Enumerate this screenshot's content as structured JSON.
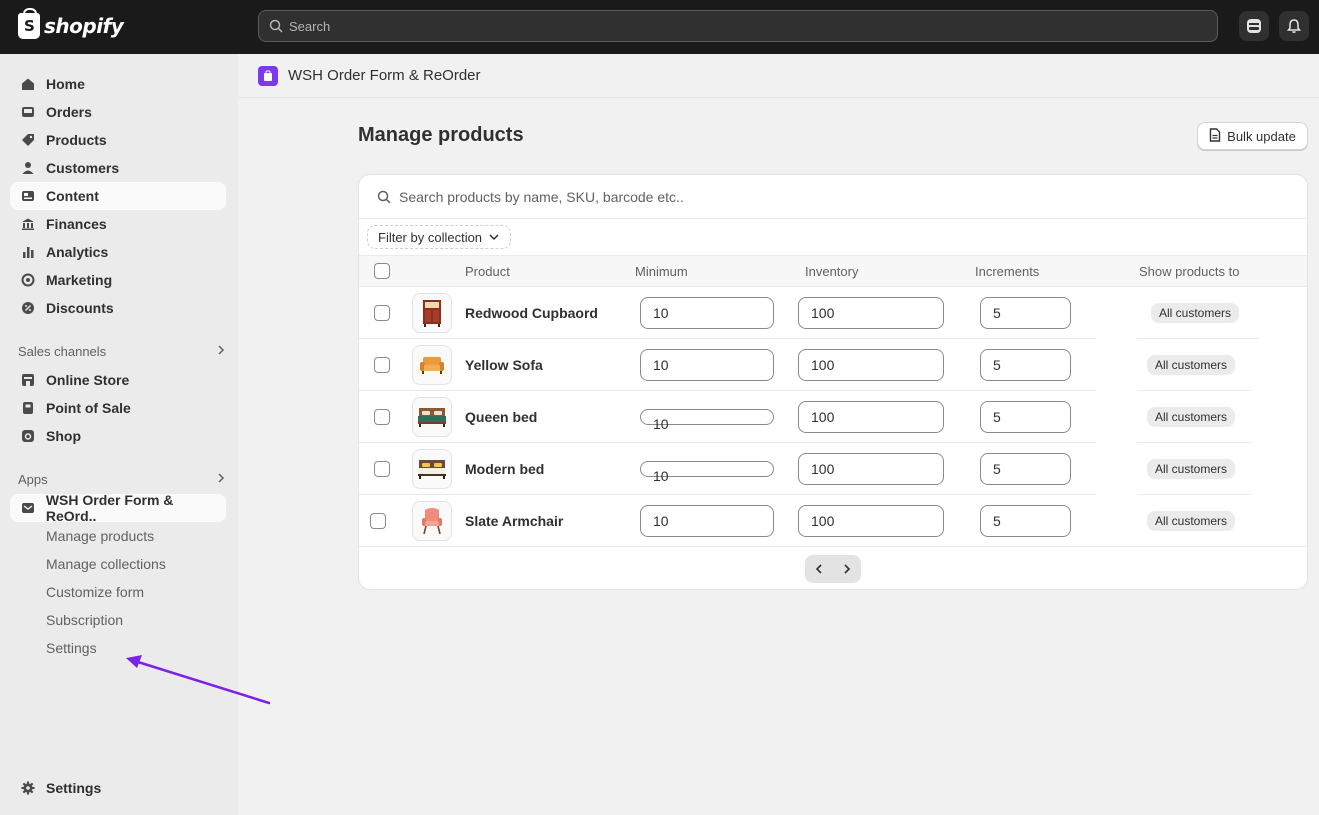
{
  "topbar": {
    "logo_text": "shopify",
    "search_placeholder": "Search"
  },
  "sidebar": {
    "nav": [
      {
        "label": "Home",
        "icon": "home-icon"
      },
      {
        "label": "Orders",
        "icon": "inbox-icon"
      },
      {
        "label": "Products",
        "icon": "tag-icon"
      },
      {
        "label": "Customers",
        "icon": "person-icon"
      },
      {
        "label": "Content",
        "icon": "image-icon"
      },
      {
        "label": "Finances",
        "icon": "bank-icon"
      },
      {
        "label": "Analytics",
        "icon": "bar-chart-icon"
      },
      {
        "label": "Marketing",
        "icon": "target-icon"
      },
      {
        "label": "Discounts",
        "icon": "discount-icon"
      }
    ],
    "sales_channels_label": "Sales channels",
    "channels": [
      {
        "label": "Online Store",
        "icon": "store-icon"
      },
      {
        "label": "Point of Sale",
        "icon": "pos-icon"
      },
      {
        "label": "Shop",
        "icon": "shop-icon"
      }
    ],
    "apps_label": "Apps",
    "app_name": "WSH Order Form & ReOrd..",
    "app_subitems": [
      "Manage products",
      "Manage collections",
      "Customize form",
      "Subscription",
      "Settings"
    ],
    "settings_label": "Settings"
  },
  "app_header": {
    "title": "WSH Order Form & ReOrder"
  },
  "main": {
    "title": "Manage products",
    "bulk_update_label": "Bulk update",
    "search_placeholder": "Search products by name, SKU, barcode etc..",
    "filter_label": "Filter by collection",
    "columns": {
      "product": "Product",
      "minimum": "Minimum",
      "inventory": "Inventory",
      "increments": "Increments",
      "show_to": "Show products to"
    },
    "rows": [
      {
        "name": "Redwood Cupbaord",
        "minimum": "10",
        "inventory": "100",
        "increments": "5",
        "show_to": "All customers"
      },
      {
        "name": "Yellow Sofa",
        "minimum": "10",
        "inventory": "100",
        "increments": "5",
        "show_to": "All customers"
      },
      {
        "name": "Queen bed",
        "minimum": "10",
        "inventory": "100",
        "increments": "5",
        "show_to": "All customers"
      },
      {
        "name": "Modern bed",
        "minimum": "10",
        "inventory": "100",
        "increments": "5",
        "show_to": "All customers"
      },
      {
        "name": "Slate Armchair",
        "minimum": "10",
        "inventory": "100",
        "increments": "5",
        "show_to": "All customers"
      }
    ]
  },
  "colors": {
    "topbar": "#1a1a1a",
    "sidebar": "#ebebeb",
    "background": "#f1f1f1",
    "app_icon": "#7c3aed",
    "annotation_arrow": "#7c22e6"
  }
}
